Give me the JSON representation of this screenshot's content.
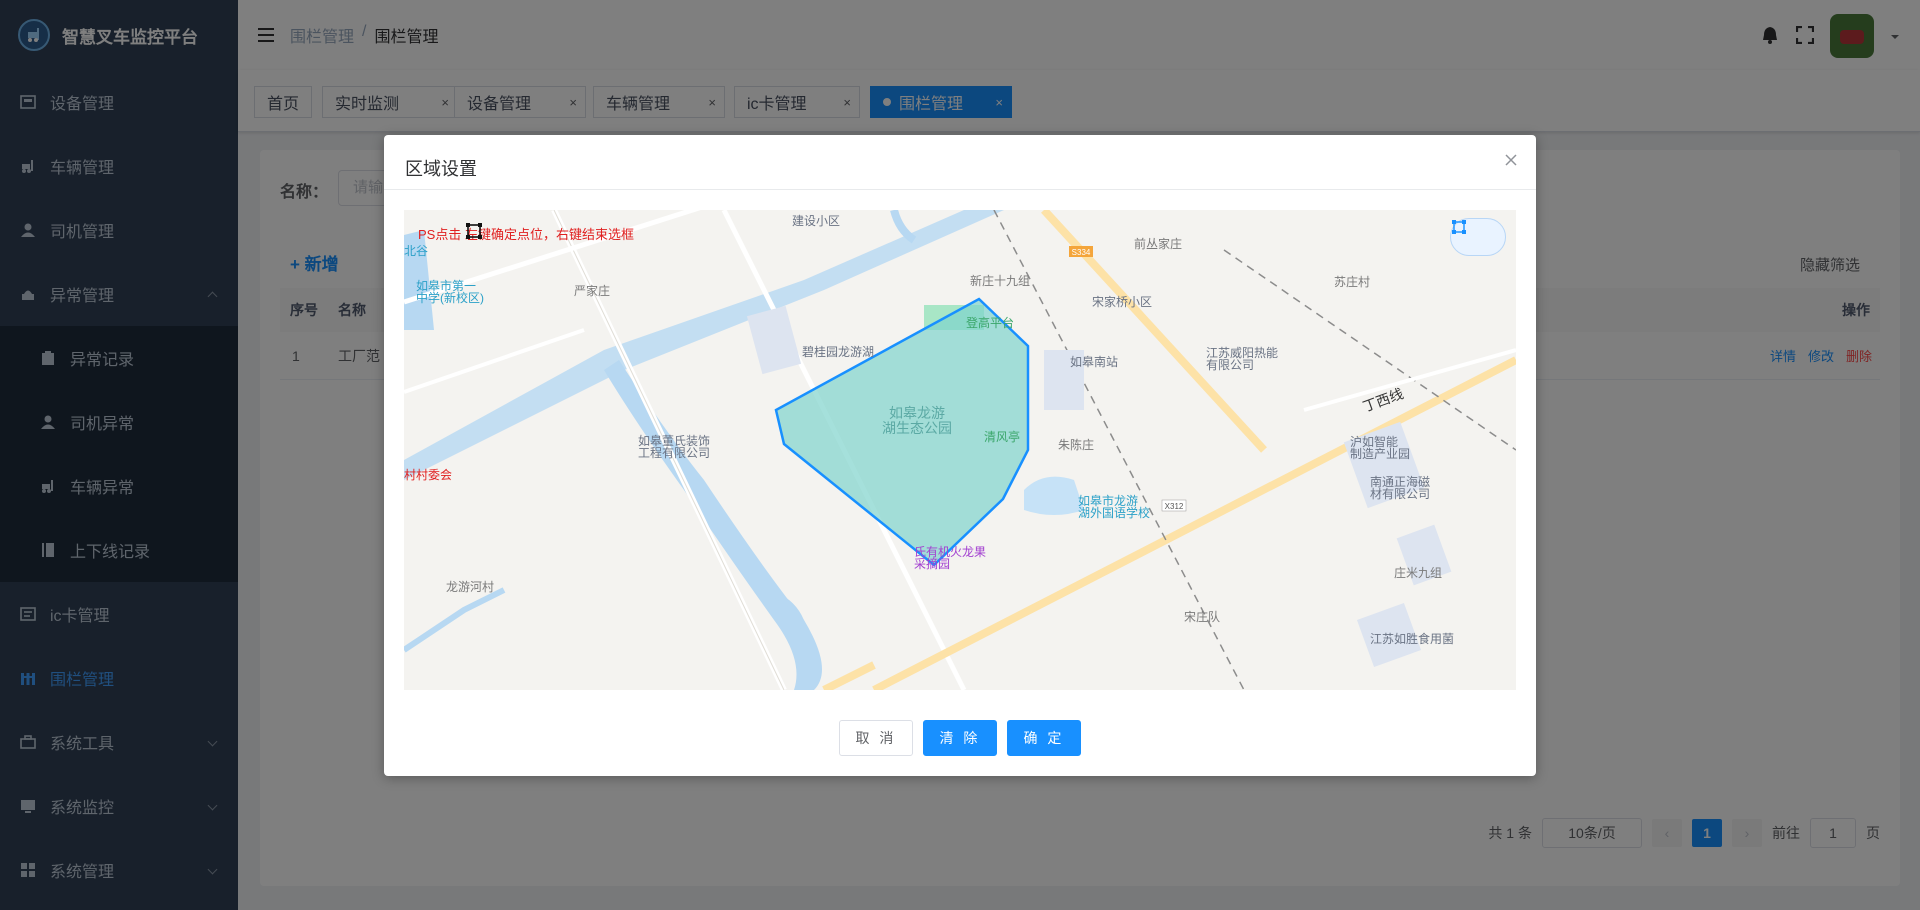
{
  "app": {
    "title": "智慧叉车监控平台"
  },
  "sidebar": {
    "items": [
      {
        "label": "设备管理",
        "icon": "device-icon"
      },
      {
        "label": "车辆管理",
        "icon": "forklift-icon"
      },
      {
        "label": "司机管理",
        "icon": "user-icon"
      },
      {
        "label": "异常管理",
        "icon": "warning-icon"
      },
      {
        "label": "ic卡管理",
        "icon": "card-icon"
      },
      {
        "label": "围栏管理",
        "icon": "fence-icon"
      },
      {
        "label": "系统工具",
        "icon": "toolbox-icon"
      },
      {
        "label": "系统监控",
        "icon": "monitor-icon"
      },
      {
        "label": "系统管理",
        "icon": "grid-icon"
      }
    ],
    "submenu": [
      {
        "label": "异常记录",
        "icon": "record-icon"
      },
      {
        "label": "司机异常",
        "icon": "driver-icon"
      },
      {
        "label": "车辆异常",
        "icon": "forklift-icon"
      },
      {
        "label": "上下线记录",
        "icon": "book-icon"
      }
    ]
  },
  "header": {
    "breadcrumb": [
      "围栏管理",
      "/",
      "围栏管理"
    ]
  },
  "tags": [
    {
      "label": "首页"
    },
    {
      "label": "实时监测"
    },
    {
      "label": "设备管理"
    },
    {
      "label": "车辆管理"
    },
    {
      "label": "ic卡管理"
    },
    {
      "label": "围栏管理",
      "active": true
    }
  ],
  "tag_close": "×",
  "main": {
    "search_label": "名称：",
    "search_placeholder": "请输",
    "add_button": "+ 新增",
    "hide_filter": "隐藏筛选",
    "table": {
      "columns": [
        "序号",
        "名称",
        "操作"
      ],
      "rows": [
        {
          "index": "1",
          "name": "工厂范"
        }
      ],
      "ops": [
        "详情",
        "修改",
        "删除"
      ]
    },
    "pagination": {
      "total": "共 1 条",
      "page_size": "10条/页",
      "current": "1",
      "goto_label": "前往",
      "goto_value": "1",
      "goto_suffix": "页",
      "prev": "‹",
      "next": "›"
    }
  },
  "dialog": {
    "title": "区域设置",
    "hint": "PS点击    左键确定点位，右键结束选框",
    "map_labels": {
      "jianshe": "建设小区",
      "qiancong": "前丛家庄",
      "suzhuang": "苏庄村",
      "yanjia": "严家庄",
      "xinzhuang": "新庄十九组",
      "songjiaqiao": "宋家桥小区",
      "s334": "S334",
      "zhongxue": "如皋市第一\n中学(新校区)",
      "biguiyuan": "碧桂园龙游湖",
      "denggao": "登高平台",
      "rugaonan": "如皋南站",
      "weiyang": "江苏威阳热能\n有限公司",
      "park": "如皋龙游\n湖生态公园",
      "qingfeng": "清风亭",
      "zhuchen": "朱陈庄",
      "dingxi": "丁西线",
      "huru": "沪如智能\n制造产业园",
      "dongshi": "如皋董氏装饰\n工程有限公司",
      "cunwei": "村村委会",
      "longyou_school": "如皋市龙游\n湖外国语学校",
      "x312": "X312",
      "nantong": "南通正海磁\n材有限公司",
      "huolong": "氏有机火龙果\n采摘园",
      "zhuangmi": "庄米九组",
      "longyouhe": "龙游河村",
      "songzhuang": "宋庄队",
      "rusheng": "江苏如胜食用菌",
      "beigu": "北谷"
    },
    "buttons": {
      "cancel": "取 消",
      "clear": "清 除",
      "confirm": "确 定"
    },
    "fence_color": "#1890ff"
  }
}
